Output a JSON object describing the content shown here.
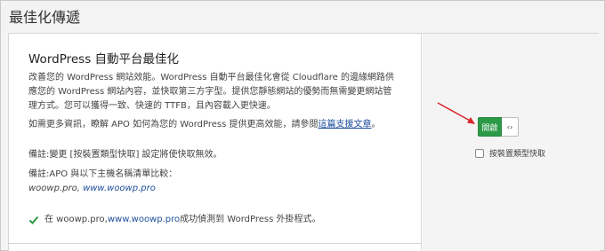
{
  "section": {
    "title": "最佳化傳遞"
  },
  "card": {
    "title": "WordPress 自動平台最佳化",
    "description_lines": [
      "改善您的 WordPress 網站效能。WordPress 自動平台最佳化會從 Cloudflare 的邊緣網路供",
      "應您的 WordPress 網站內容，並快取第三方字型。提供您靜態網站的優勢而無需變更網站管",
      "理方式。您可以獲得一致、快速的 TTFB，且內容載入更快速。"
    ],
    "more_info": {
      "prefix": "如需更多資訊，瞭解 APO 如何為您的 WordPress 提供更高效能，請參閱",
      "link": "這篇支援文章",
      "suffix": "。"
    },
    "note1": "備註:變更 [按裝置類型快取] 設定將使快取無效。",
    "note2": {
      "label": "備註:APO 與以下主機名稱清單比較：",
      "host1": "woowp.pro",
      "sep": ", ",
      "host2": "www.woowp.pro"
    },
    "status": {
      "prefix": "在 woowp.pro, ",
      "link": "www.woowp.pro",
      "suffix": " 成功偵測到 WordPress 外掛程式。"
    }
  },
  "toggle": {
    "on_label": "開啟",
    "handle_glyph": "‹›",
    "state": "on"
  },
  "checkbox": {
    "label": "按裝置類型快取",
    "checked": false
  },
  "colors": {
    "toggle_on": "#2d9a48",
    "link": "#1e4f9c",
    "check": "#2d9a48",
    "arrow": "#d9262b"
  },
  "icons": {
    "status": "check-icon",
    "annotation": "red-arrow"
  }
}
